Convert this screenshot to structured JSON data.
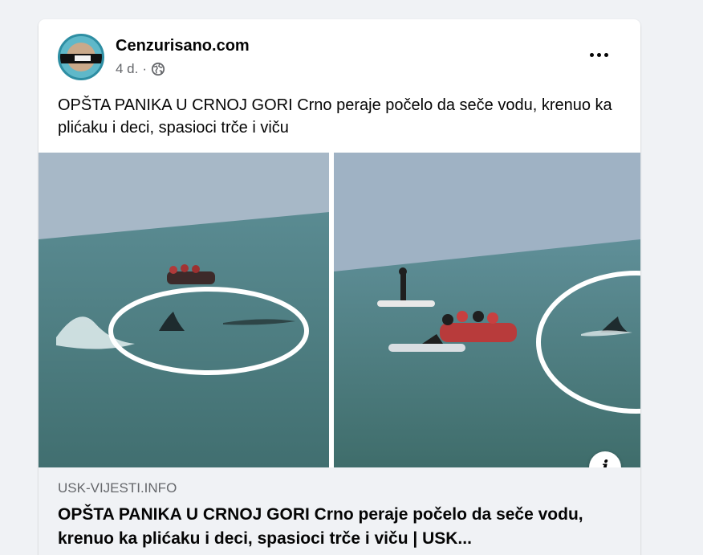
{
  "post": {
    "page_name": "Cenzurisano.com",
    "time": "4 d.",
    "separator": "·",
    "privacy_icon": "globe-icon",
    "more_icon": "more-horizontal-icon",
    "text": "OPŠTA PANIKA U CRNOJ GORI Crno peraje počelo da seče vodu, krenuo ka plićaku i deci, spasioci trče i viču"
  },
  "link_preview": {
    "info_icon": "info-icon",
    "info_glyph": "i",
    "domain": "USK-VIJESTI.INFO",
    "title": "OPŠTA PANIKA U CRNOJ GORI Crno peraje počelo da seče vodu, krenuo ka plićaku i deci, spasioci trče i viču | USK..."
  },
  "colors": {
    "background": "#f0f2f5",
    "card": "#ffffff",
    "primary_text": "#050505",
    "secondary_text": "#65676b",
    "sea": "#4f7f86",
    "sky": "#9fb2c4"
  }
}
